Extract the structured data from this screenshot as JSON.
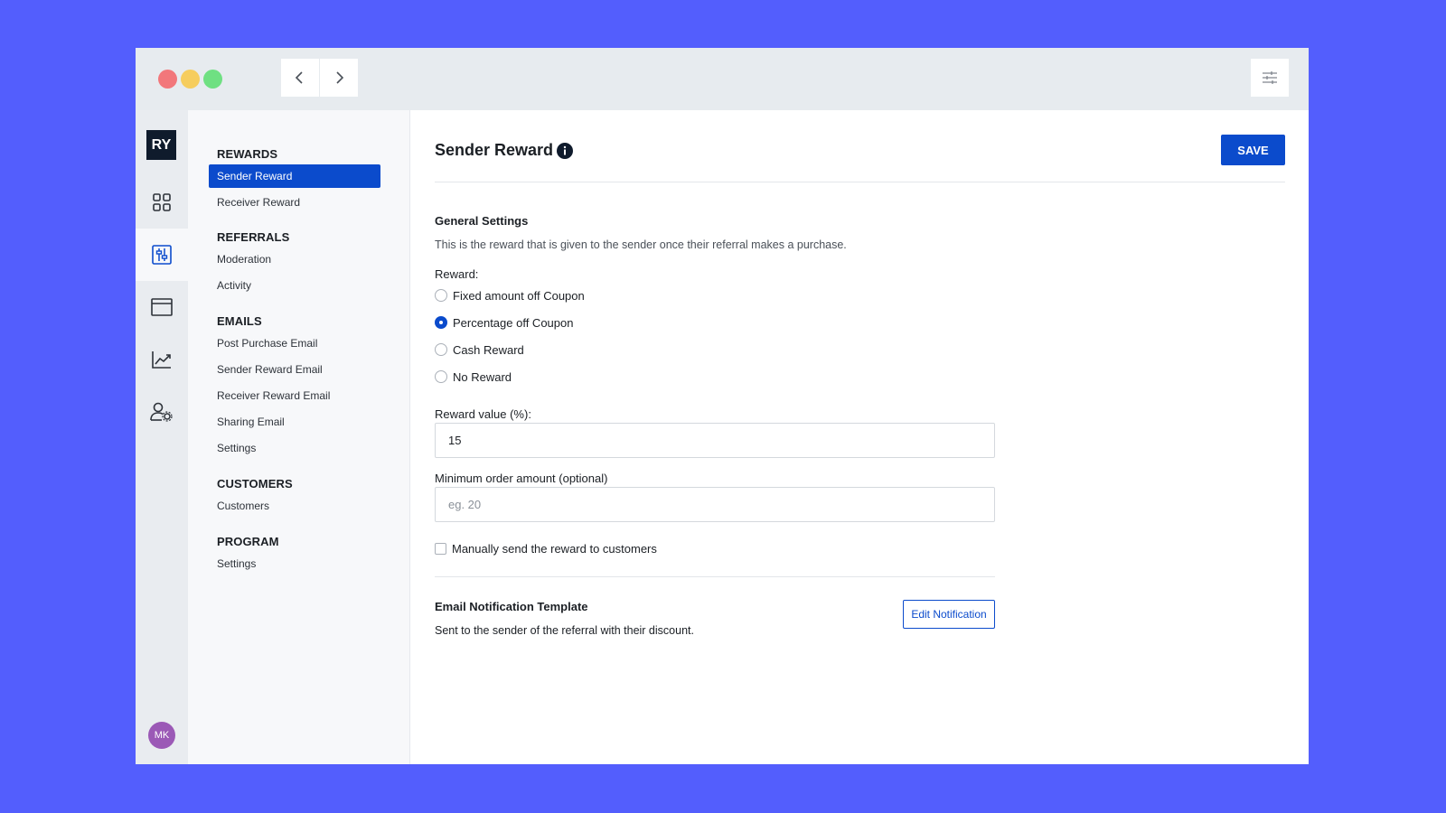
{
  "app": {
    "logo_text": "RY",
    "user_initials": "MK",
    "accent_color": "#0b4bcc",
    "background_color": "#535efd"
  },
  "toolbar": {
    "back_icon": "chevron-left-icon",
    "forward_icon": "chevron-right-icon",
    "menu_icon": "sliders-icon"
  },
  "rail": {
    "items": [
      {
        "icon": "grid-icon",
        "active": false
      },
      {
        "icon": "sliders-panel-icon",
        "active": true
      },
      {
        "icon": "browser-window-icon",
        "active": false
      },
      {
        "icon": "trending-chart-icon",
        "active": false
      },
      {
        "icon": "user-settings-icon",
        "active": false
      }
    ]
  },
  "subnav": {
    "sections": [
      {
        "title": "REWARDS",
        "items": [
          "Sender Reward",
          "Receiver Reward"
        ]
      },
      {
        "title": "REFERRALS",
        "items": [
          "Moderation",
          "Activity"
        ]
      },
      {
        "title": "EMAILS",
        "items": [
          "Post Purchase Email",
          "Sender Reward Email",
          "Receiver Reward Email",
          "Sharing Email",
          "Settings"
        ]
      },
      {
        "title": "CUSTOMERS",
        "items": [
          "Customers"
        ]
      },
      {
        "title": "PROGRAM",
        "items": [
          "Settings"
        ]
      }
    ],
    "active_item": "Sender Reward"
  },
  "main": {
    "title": "Sender Reward",
    "save_label": "SAVE",
    "general": {
      "heading": "General Settings",
      "description": "This is the reward that is given to the sender once their referral makes a purchase.",
      "reward_label": "Reward:",
      "options": [
        "Fixed amount off Coupon",
        "Percentage off Coupon",
        "Cash Reward",
        "No Reward"
      ],
      "selected_option": "Percentage off Coupon",
      "reward_value_label": "Reward value (%):",
      "reward_value": "15",
      "min_order_label": "Minimum order amount (optional)",
      "min_order_placeholder": "eg. 20",
      "manual_send_label": "Manually send the reward to customers",
      "manual_send_checked": false
    },
    "email": {
      "heading": "Email Notification Template",
      "description": "Sent to the sender of the referral with their discount.",
      "edit_label": "Edit Notification"
    }
  }
}
